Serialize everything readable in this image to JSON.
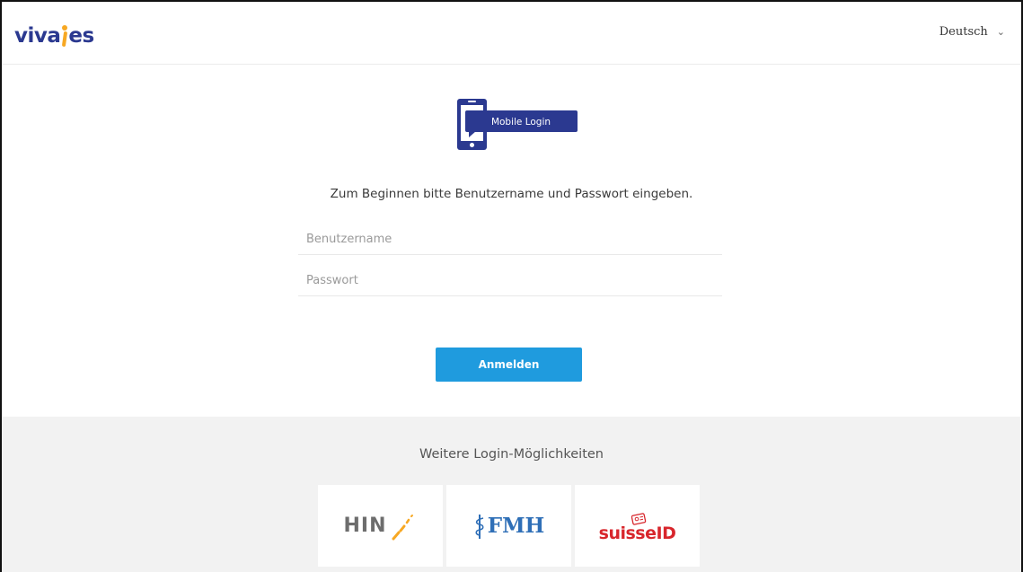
{
  "header": {
    "logo_text_left": "viva",
    "logo_text_right": "es",
    "language": "Deutsch",
    "language_chevron": "⌄"
  },
  "badge": {
    "label": "Mobile Login",
    "icon": "mobile-phone-icon"
  },
  "login": {
    "intro": "Zum Beginnen bitte Benutzername und Passwort eingeben.",
    "username_placeholder": "Benutzername",
    "password_placeholder": "Passwort",
    "submit_label": "Anmelden"
  },
  "footer": {
    "title": "Weitere Login-Möglichkeiten",
    "providers": [
      {
        "label": "HIN"
      },
      {
        "label": "FMH"
      },
      {
        "label": "suisseID"
      }
    ]
  },
  "colors": {
    "brand_blue": "#2b3990",
    "brand_orange": "#f7a823",
    "button_blue": "#1f9bde",
    "fmh_blue": "#2f6fb7",
    "suisseid_red": "#d8262c",
    "footer_bg": "#f2f2f2"
  }
}
